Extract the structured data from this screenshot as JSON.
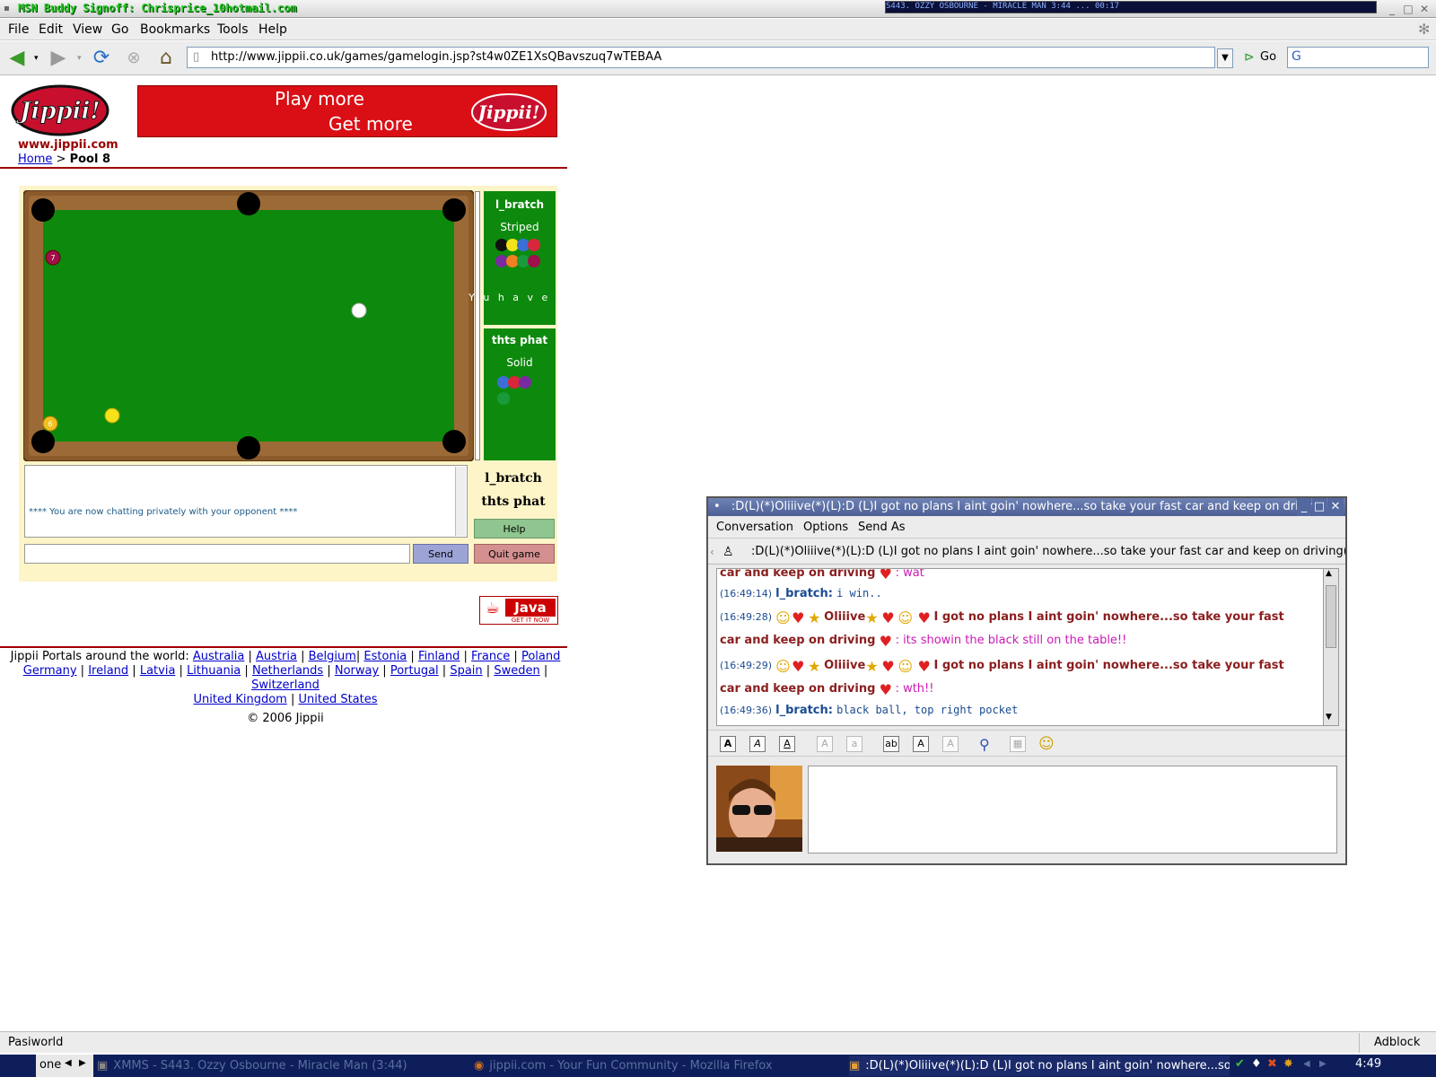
{
  "window": {
    "title": "MSN Buddy Signoff: Chrisprice_10hotmail.com",
    "xmms_widget": "S443. OZZY OSBOURNE - MIRACLE MAN   3:44   ...   00:17"
  },
  "menubar": [
    "File",
    "Edit",
    "View",
    "Go",
    "Bookmarks",
    "Tools",
    "Help"
  ],
  "navbar": {
    "url": "http://www.jippii.co.uk/games/gamelogin.jsp?st4w0ZE1XsQBavszuq7wTEBAA",
    "go_label": "Go"
  },
  "site": {
    "logo_text": "Jippii!",
    "url_text": "www.jippii.com",
    "breadcrumb_home": "Home",
    "breadcrumb_sep": ">",
    "breadcrumb_current": "Pool 8",
    "banner_line1": "Play more",
    "banner_line2": "Get more",
    "banner_logo": "Jippii!"
  },
  "game": {
    "player1": {
      "name": "l_bratch",
      "type": "Striped",
      "balls": [
        "8",
        "9",
        "10",
        "11",
        "12",
        "13",
        "14",
        "15"
      ]
    },
    "player2": {
      "name": "thts phat",
      "type": "Solid",
      "balls": [
        "2",
        "3",
        "4",
        "6"
      ]
    },
    "scroll_message": "Y u  h a v e  w",
    "chat_notice": "**** You are now chatting privately with your opponent ****",
    "names": [
      "l_bratch",
      "thts phat"
    ],
    "help_label": "Help",
    "send_label": "Send",
    "quit_label": "Quit game",
    "table_balls": [
      {
        "label": "7",
        "color": "#a0104a"
      },
      {
        "label": "",
        "color": "#ffffff"
      },
      {
        "label": "",
        "color": "#f5e21a"
      },
      {
        "label": "6",
        "color": "#f0c020"
      }
    ]
  },
  "java_badge": {
    "logo": "Java",
    "tagline": "GET IT NOW"
  },
  "portals": {
    "intro": "Jippii Portals around the world:",
    "countries": [
      "Australia",
      "Austria",
      "Belgium",
      "Estonia",
      "Finland",
      "France",
      "Poland",
      "Germany",
      "Ireland",
      "Latvia",
      "Lithuania",
      "Netherlands",
      "Norway",
      "Portugal",
      "Spain",
      "Sweden",
      "Switzerland",
      "United Kingdom",
      "United States"
    ],
    "copyright": "© 2006 Jippii"
  },
  "statusbar": {
    "text": "Pasiworld",
    "adblock": "Adblock"
  },
  "taskbar": {
    "workspace": "one",
    "task1": "XMMS - S443. Ozzy Osbourne - Miracle Man (3:44)",
    "task2": "jippii.com - Your Fun Community - Mozilla Firefox",
    "task3": ":D(L)(*)Oliiive(*)(L):D (L)I got no plans I aint goin' nowhere...so",
    "clock": "4:49"
  },
  "im": {
    "title": ":D(L)(*)Oliiive(*)(L):D (L)I got no plans I aint goin' nowhere...so take your fast car and keep on drivin",
    "menu": [
      "Conversation",
      "Options",
      "Send As"
    ],
    "topic": ":D(L)(*)Oliiive(*)(L):D (L)I got no plans I aint goin' nowhere...so take your fast car and keep on driving(L)",
    "messages": [
      {
        "time": "",
        "nick": "car and keep on driving",
        "text": ": wat"
      },
      {
        "time": "(16:49:14)",
        "nick": "l_bratch:",
        "text": "i win.."
      },
      {
        "time": "(16:49:28)",
        "nick": "Oliiive",
        "text": "I got no plans I aint goin' nowhere...so take your fast"
      },
      {
        "time": "",
        "nick": "car and keep on driving",
        "text": ": its showin the black still on the table!!"
      },
      {
        "time": "(16:49:29)",
        "nick": "Oliiive",
        "text": "I got no plans I aint goin' nowhere...so take your fast"
      },
      {
        "time": "",
        "nick": "car and keep on driving",
        "text": ": wth!!"
      },
      {
        "time": "(16:49:36)",
        "nick": "l_bratch:",
        "text": "black ball, top right pocket"
      }
    ],
    "input_value": ""
  },
  "colors": {
    "felt": "#0d8a0d",
    "banner_red": "#d90f15",
    "game_bg": "#fdf5c8",
    "im_title": "#5468a0"
  }
}
